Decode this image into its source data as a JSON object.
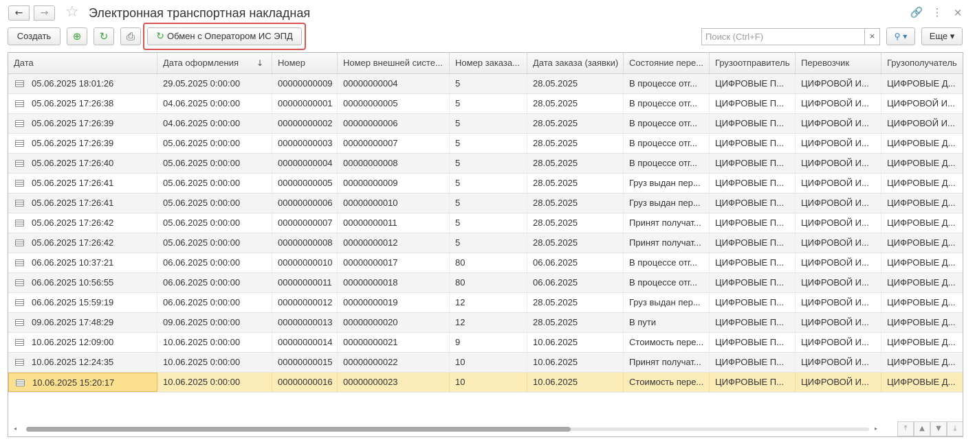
{
  "window": {
    "title": "Электронная транспортная накладная",
    "back_icon": "←",
    "forward_icon": "→",
    "star_icon": "☆",
    "link_icon": "🔗",
    "menu_icon": "⋮",
    "close_icon": "×"
  },
  "toolbar": {
    "create_label": "Создать",
    "copy_icon": "⊕",
    "refresh_icon": "↻",
    "print_icon": "⎙",
    "exchange_label": "Обмен с Оператором ИС ЭПД",
    "exchange_icon": "↻",
    "search_placeholder": "Поиск (Ctrl+F)",
    "search_clear": "×",
    "search_button_icon": "⚲ ▾",
    "more_label": "Еще ▾"
  },
  "colors": {
    "accent_green": "#3ea33e",
    "highlight_border": "#d9534f",
    "selected_row": "#fbecb8"
  },
  "table": {
    "columns": [
      "Дата",
      "Дата оформления",
      "Номер",
      "Номер внешней систе...",
      "Номер заказа...",
      "Дата заказа (заявки)",
      "Состояние пере...",
      "Грузоотправитель",
      "Перевозчик",
      "Грузополучатель"
    ],
    "sort_arrow": "↓",
    "rows": [
      [
        "05.06.2025 18:01:26",
        "29.05.2025 0:00:00",
        "00000000009",
        "00000000004",
        "5",
        "28.05.2025",
        "В процессе отг...",
        "ЦИФРОВЫЕ П...",
        "ЦИФРОВОЙ И...",
        "ЦИФРОВЫЕ Д..."
      ],
      [
        "05.06.2025 17:26:38",
        "04.06.2025 0:00:00",
        "00000000001",
        "00000000005",
        "5",
        "28.05.2025",
        "В процессе отг...",
        "ЦИФРОВЫЕ П...",
        "ЦИФРОВОЙ И...",
        "ЦИФРОВОЙ И..."
      ],
      [
        "05.06.2025 17:26:39",
        "04.06.2025 0:00:00",
        "00000000002",
        "00000000006",
        "5",
        "28.05.2025",
        "В процессе отг...",
        "ЦИФРОВЫЕ П...",
        "ЦИФРОВОЙ И...",
        "ЦИФРОВОЙ И..."
      ],
      [
        "05.06.2025 17:26:39",
        "05.06.2025 0:00:00",
        "00000000003",
        "00000000007",
        "5",
        "28.05.2025",
        "В процессе отг...",
        "ЦИФРОВЫЕ П...",
        "ЦИФРОВОЙ И...",
        "ЦИФРОВЫЕ Д..."
      ],
      [
        "05.06.2025 17:26:40",
        "05.06.2025 0:00:00",
        "00000000004",
        "00000000008",
        "5",
        "28.05.2025",
        "В процессе отг...",
        "ЦИФРОВЫЕ П...",
        "ЦИФРОВОЙ И...",
        "ЦИФРОВЫЕ Д..."
      ],
      [
        "05.06.2025 17:26:41",
        "05.06.2025 0:00:00",
        "00000000005",
        "00000000009",
        "5",
        "28.05.2025",
        "Груз выдан пер...",
        "ЦИФРОВЫЕ П...",
        "ЦИФРОВОЙ И...",
        "ЦИФРОВЫЕ Д..."
      ],
      [
        "05.06.2025 17:26:41",
        "05.06.2025 0:00:00",
        "00000000006",
        "00000000010",
        "5",
        "28.05.2025",
        "Груз выдан пер...",
        "ЦИФРОВЫЕ П...",
        "ЦИФРОВОЙ И...",
        "ЦИФРОВЫЕ Д..."
      ],
      [
        "05.06.2025 17:26:42",
        "05.06.2025 0:00:00",
        "00000000007",
        "00000000011",
        "5",
        "28.05.2025",
        "Принят получат...",
        "ЦИФРОВЫЕ П...",
        "ЦИФРОВОЙ И...",
        "ЦИФРОВЫЕ Д..."
      ],
      [
        "05.06.2025 17:26:42",
        "05.06.2025 0:00:00",
        "00000000008",
        "00000000012",
        "5",
        "28.05.2025",
        "Принят получат...",
        "ЦИФРОВЫЕ П...",
        "ЦИФРОВОЙ И...",
        "ЦИФРОВЫЕ Д..."
      ],
      [
        "06.06.2025 10:37:21",
        "06.06.2025 0:00:00",
        "00000000010",
        "00000000017",
        "80",
        "06.06.2025",
        "В процессе отг...",
        "ЦИФРОВЫЕ П...",
        "ЦИФРОВОЙ И...",
        "ЦИФРОВЫЕ Д..."
      ],
      [
        "06.06.2025 10:56:55",
        "06.06.2025 0:00:00",
        "00000000011",
        "00000000018",
        "80",
        "06.06.2025",
        "В процессе отг...",
        "ЦИФРОВЫЕ П...",
        "ЦИФРОВОЙ И...",
        "ЦИФРОВЫЕ Д..."
      ],
      [
        "06.06.2025 15:59:19",
        "06.06.2025 0:00:00",
        "00000000012",
        "00000000019",
        "12",
        "28.05.2025",
        "Груз выдан пер...",
        "ЦИФРОВЫЕ П...",
        "ЦИФРОВОЙ И...",
        "ЦИФРОВЫЕ Д..."
      ],
      [
        "09.06.2025 17:48:29",
        "09.06.2025 0:00:00",
        "00000000013",
        "00000000020",
        "12",
        "28.05.2025",
        "В пути",
        "ЦИФРОВЫЕ П...",
        "ЦИФРОВОЙ И...",
        "ЦИФРОВЫЕ Д..."
      ],
      [
        "10.06.2025 12:09:00",
        "10.06.2025 0:00:00",
        "00000000014",
        "00000000021",
        "9",
        "10.06.2025",
        "Стоимость пере...",
        "ЦИФРОВЫЕ П...",
        "ЦИФРОВОЙ И...",
        "ЦИФРОВЫЕ Д..."
      ],
      [
        "10.06.2025 12:24:35",
        "10.06.2025 0:00:00",
        "00000000015",
        "00000000022",
        "10",
        "10.06.2025",
        "Принят получат...",
        "ЦИФРОВЫЕ П...",
        "ЦИФРОВОЙ И...",
        "ЦИФРОВЫЕ Д..."
      ],
      [
        "10.06.2025 15:20:17",
        "10.06.2025 0:00:00",
        "00000000016",
        "00000000023",
        "10",
        "10.06.2025",
        "Стоимость пере...",
        "ЦИФРОВЫЕ П...",
        "ЦИФРОВОЙ И...",
        "ЦИФРОВЫЕ Д..."
      ]
    ],
    "selected_row_index": 15
  },
  "footer": {
    "scroll_left_icon": "◂",
    "scroll_right_icon": "▸",
    "first_icon": "⤒",
    "up_icon": "▲",
    "down_icon": "▼",
    "last_icon": "⤓"
  }
}
